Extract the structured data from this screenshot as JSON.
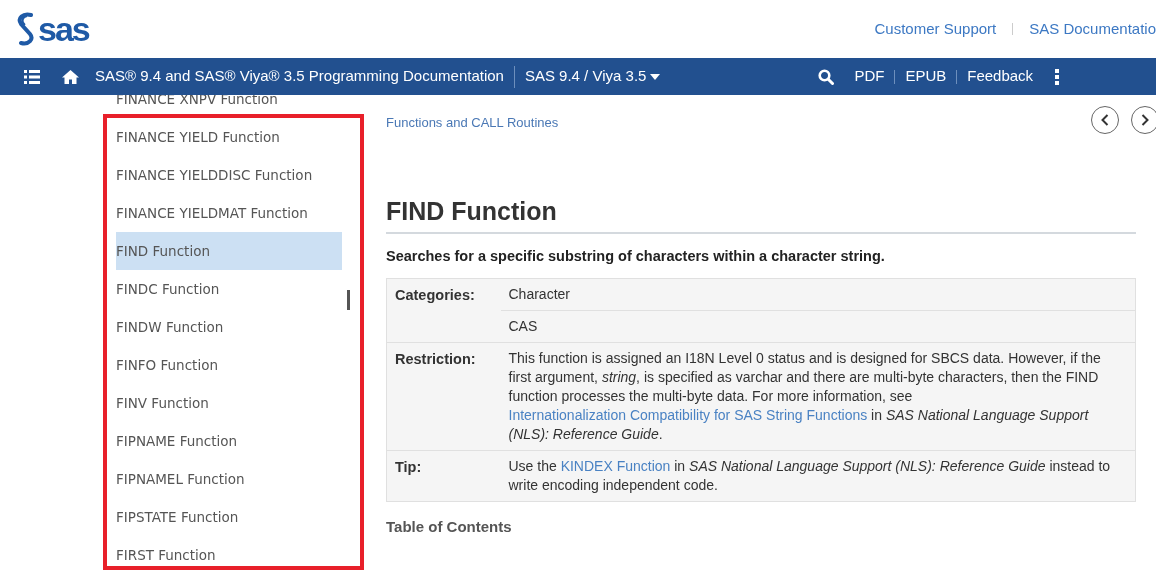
{
  "header": {
    "logo_text": "sas",
    "links": [
      "Customer Support",
      "SAS Documentatio"
    ]
  },
  "navbar": {
    "title": "SAS® 9.4 and SAS® Viya® 3.5 Programming Documentation",
    "version": "SAS 9.4 / Viya 3.5",
    "actions": [
      "PDF",
      "EPUB",
      "Feedback"
    ]
  },
  "sidebar": {
    "highlight_frame": true,
    "items": [
      {
        "label": "FINANCE XNPV Function",
        "selected": false
      },
      {
        "label": "FINANCE YIELD Function",
        "selected": false
      },
      {
        "label": "FINANCE YIELDDISC Function",
        "selected": false
      },
      {
        "label": "FINANCE YIELDMAT Function",
        "selected": false
      },
      {
        "label": "FIND Function",
        "selected": true
      },
      {
        "label": "FINDC Function",
        "selected": false
      },
      {
        "label": "FINDW Function",
        "selected": false
      },
      {
        "label": "FINFO Function",
        "selected": false
      },
      {
        "label": "FINV Function",
        "selected": false
      },
      {
        "label": "FIPNAME Function",
        "selected": false
      },
      {
        "label": "FIPNAMEL Function",
        "selected": false
      },
      {
        "label": "FIPSTATE Function",
        "selected": false
      },
      {
        "label": "FIRST Function",
        "selected": false
      }
    ]
  },
  "content": {
    "breadcrumb": "Functions and CALL Routines",
    "title": "FIND Function",
    "summary": "Searches for a specific substring of characters within a character string.",
    "properties": [
      {
        "label": "Categories:",
        "values": [
          [
            {
              "kind": "text",
              "text": "Character"
            }
          ],
          [
            {
              "kind": "text",
              "text": "CAS"
            }
          ]
        ]
      },
      {
        "label": "Restriction:",
        "values": [
          [
            {
              "kind": "text",
              "text": "This function is assigned an I18N Level 0 status and is designed for SBCS data. However, if the first argument, *string*, is specified as varchar and there are multi-byte characters, then the FIND function processes the multi-byte data. For more information, see "
            },
            {
              "kind": "link",
              "text": "Internationalization Compatibility for SAS String Functions"
            },
            {
              "kind": "text",
              "text": " in *SAS National Language Support (NLS): Reference Guide*."
            }
          ]
        ]
      },
      {
        "label": "Tip:",
        "values": [
          [
            {
              "kind": "text",
              "text": "Use the "
            },
            {
              "kind": "link",
              "text": "KINDEX Function"
            },
            {
              "kind": "text",
              "text": " in *SAS National Language Support (NLS): Reference Guide* instead to write encoding independent code."
            }
          ]
        ]
      }
    ],
    "section_heading": "Table of Contents"
  }
}
